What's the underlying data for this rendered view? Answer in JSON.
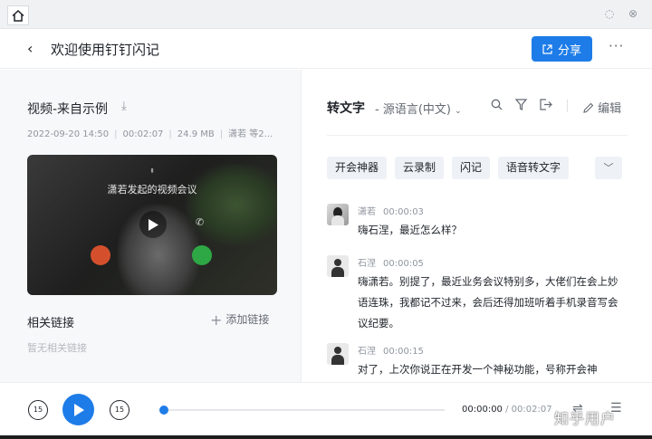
{
  "header": {
    "title": "欢迎使用钉钉闪记",
    "share_label": "分享"
  },
  "video": {
    "title": "视频-来自示例",
    "date": "2022-09-20 14:50",
    "duration": "00:02:07",
    "size": "24.9 MB",
    "participants": "潇若 等2...",
    "call_title": "潇若发起的视频会议"
  },
  "related": {
    "title": "相关链接",
    "add_label": "添加链接",
    "empty_text": "暂无相关链接"
  },
  "transcript": {
    "title": "转文字",
    "source_lang": "- 源语言(中文)",
    "edit_label": "编辑",
    "tags": [
      "开会神器",
      "云录制",
      "闪记",
      "语音转文字"
    ],
    "messages": [
      {
        "speaker": "潇若",
        "time": "00:00:03",
        "text": "嗨石涅，最近怎么样？"
      },
      {
        "speaker": "石涅",
        "time": "00:00:05",
        "text": "嗨潇若。别提了，最近业务会议特别多，大佬们在会上妙语连珠，我都记不过来，会后还得加班听着手机录音写会议纪要。"
      },
      {
        "speaker": "石涅",
        "time": "00:00:15",
        "text": "对了，上次你说正在开发一个神秘功能，号称开会神"
      }
    ]
  },
  "player": {
    "skip_back": "15",
    "skip_forward": "15",
    "current": "00:00:00",
    "total": "/ 00:02:07",
    "progress": 0
  },
  "watermark": "知乎用户",
  "colors": {
    "accent": "#1e7ce8"
  }
}
